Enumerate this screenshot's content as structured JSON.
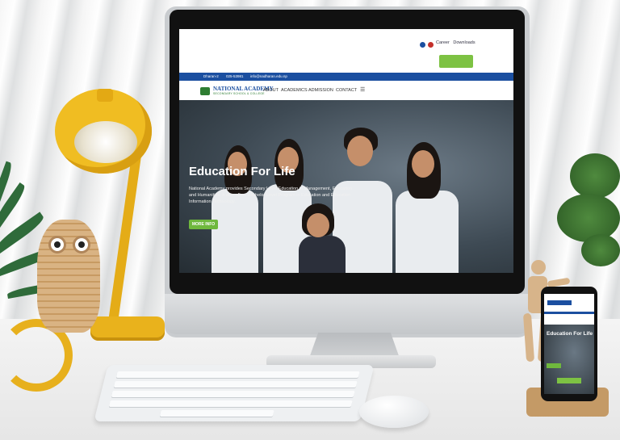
{
  "website": {
    "topbar": {
      "links": [
        "Career",
        "Downloads"
      ],
      "icons": [
        "facebook-icon",
        "youtube-icon"
      ]
    },
    "infobar": {
      "location": "Dharan-2",
      "phone": "025-53981",
      "email": "info@nadharan.edu.np"
    },
    "logo": {
      "title": "NATIONAL ACADEMY",
      "subtitle": "SECONDARY SCHOOL & COLLEGE"
    },
    "nav": [
      "ABOUT",
      "ACADEMICS",
      "ADMISSION",
      "CONTACT"
    ],
    "hero": {
      "title": "Education For Life",
      "text": "National Academy provides Secondary Level Education in Management, Education and Humanities. It also offers Bachelor Level Program in Education and Education Information Technology.",
      "button": "MORE INFO"
    }
  },
  "phone_site": {
    "hero_title": "Education For Life"
  },
  "colors": {
    "brand_blue": "#1b4fa0",
    "brand_green": "#6fb83d",
    "lamp_yellow": "#f0bd22"
  }
}
